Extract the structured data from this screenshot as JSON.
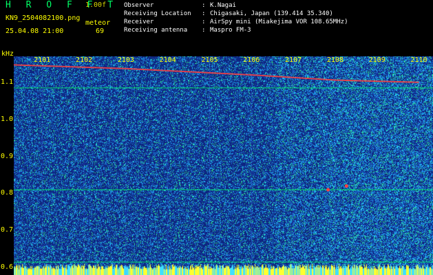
{
  "header": {
    "app_title": "H R O F F T",
    "version": "1.00f",
    "filename": "KN9_2504082100.png",
    "meteor_label": "meteor",
    "datetime": "25.04.08 21:00",
    "meteor_count": "69"
  },
  "info": [
    {
      "key": "Observer",
      "value": "K.Nagai"
    },
    {
      "key": "Receiving Location",
      "value": "Chigasaki, Japan (139.414 35.340)"
    },
    {
      "key": "Receiver",
      "value": "AirSpy mini (Miakejima VOR 108.65MHz)"
    },
    {
      "key": "Receiving antenna",
      "value": "Maspro FM-3"
    }
  ],
  "colors": {
    "background": "#000000",
    "waterfall_base": "#0a2080",
    "noise_light": "#22c0ff",
    "noise_mid": "#2fa8ff",
    "noise_green": "#30ff90",
    "trace": "#ff4040",
    "gridline": "#00ff66",
    "label": "#ffff00"
  },
  "chart_data": {
    "type": "heatmap",
    "ylabel": "kHz",
    "ylim": [
      0.58,
      1.17
    ],
    "y_ticks": [
      "1.1",
      "1.0",
      "0.9",
      "0.8",
      "0.7",
      "0.6"
    ],
    "x_ticks": [
      "2101",
      "2102",
      "2103",
      "2104",
      "2105",
      "2106",
      "2107",
      "2108",
      "2109",
      "2110"
    ],
    "x_minutes": [
      1,
      2,
      3,
      4,
      5,
      6,
      7,
      8,
      9,
      10
    ],
    "reference_lines_khz": [
      1.085,
      0.81,
      0.615
    ],
    "carrier_trace": [
      {
        "minute": 0.0,
        "khz": 1.147
      },
      {
        "minute": 3.0,
        "khz": 1.137
      },
      {
        "minute": 6.0,
        "khz": 1.12
      },
      {
        "minute": 8.0,
        "khz": 1.106
      },
      {
        "minute": 10.0,
        "khz": 1.1
      }
    ],
    "meteor_pings": [
      {
        "minute": 7.83,
        "khz": 0.81
      },
      {
        "minute": 8.27,
        "khz": 0.82
      }
    ]
  }
}
